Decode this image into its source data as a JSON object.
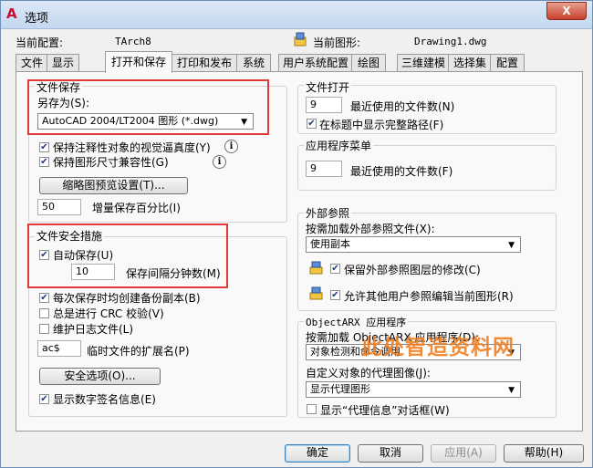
{
  "window": {
    "title": "选项",
    "close_label": "X"
  },
  "header": {
    "current_profile_label": "当前配置:",
    "current_profile_value": "TArch8",
    "current_drawing_label": "当前图形:",
    "current_drawing_value": "Drawing1.dwg"
  },
  "tabs": [
    "文件",
    "显示",
    "打开和保存",
    "打印和发布",
    "系统",
    "用户系统配置",
    "绘图",
    "三维建模",
    "选择集",
    "配置"
  ],
  "active_tab": "打开和保存",
  "file_save": {
    "title": "文件保存",
    "save_as_label": "另存为(S):",
    "save_as_value": "AutoCAD 2004/LT2004 图形 (*.dwg)",
    "keep_annotative": {
      "label": "保持注释性对象的视觉逼真度(Y)",
      "checked": true
    },
    "maintain_size": {
      "label": "保持图形尺寸兼容性(G)",
      "checked": true
    },
    "thumbnail_button": "缩略图预览设置(T)...",
    "incremental_value": "50",
    "incremental_label": "增量保存百分比(I)"
  },
  "file_safety": {
    "title": "文件安全措施",
    "autosave": {
      "label": "自动保存(U)",
      "checked": true
    },
    "autosave_minutes": "10",
    "autosave_interval_label": "保存间隔分钟数(M)",
    "backup_copy": {
      "label": "每次保存时均创建备份副本(B)",
      "checked": true
    },
    "crc_check": {
      "label": "总是进行 CRC 校验(V)",
      "checked": false
    },
    "log_file": {
      "label": "维护日志文件(L)",
      "checked": false
    },
    "temp_ext_value": "ac$",
    "temp_ext_label": "临时文件的扩展名(P)",
    "security_button": "安全选项(O)...",
    "digital_signature": {
      "label": "显示数字签名信息(E)",
      "checked": true
    }
  },
  "file_open": {
    "title": "文件打开",
    "recent_count": "9",
    "recent_label": "最近使用的文件数(N)",
    "full_path": {
      "label": "在标题中显示完整路径(F)",
      "checked": true
    }
  },
  "app_menu": {
    "title": "应用程序菜单",
    "recent_count": "9",
    "recent_label": "最近使用的文件数(F)"
  },
  "xref": {
    "title": "外部参照",
    "demand_load_label": "按需加载外部参照文件(X):",
    "demand_load_value": "使用副本",
    "retain_changes": {
      "label": "保留外部参照图层的修改(C)",
      "checked": true
    },
    "allow_edit": {
      "label": "允许其他用户参照编辑当前图形(R)",
      "checked": true
    }
  },
  "objectarx": {
    "title": "ObjectARX 应用程序",
    "demand_load_label": "按需加载 ObjectARX 应用程序(D):",
    "demand_load_value": "对象检测和命令调用",
    "proxy_label": "自定义对象的代理图像(J):",
    "proxy_value": "显示代理图形",
    "proxy_dialog": {
      "label": "显示“代理信息”对话框(W)",
      "checked": false
    }
  },
  "watermark": "此处智造资料网",
  "footer": {
    "ok": "确定",
    "cancel": "取消",
    "apply": "应用(A)",
    "help": "帮助(H)"
  },
  "colors": {
    "highlight_box": "#e03a3a",
    "title_bar": "#c5d8ef",
    "watermark": "#ef7f22"
  }
}
